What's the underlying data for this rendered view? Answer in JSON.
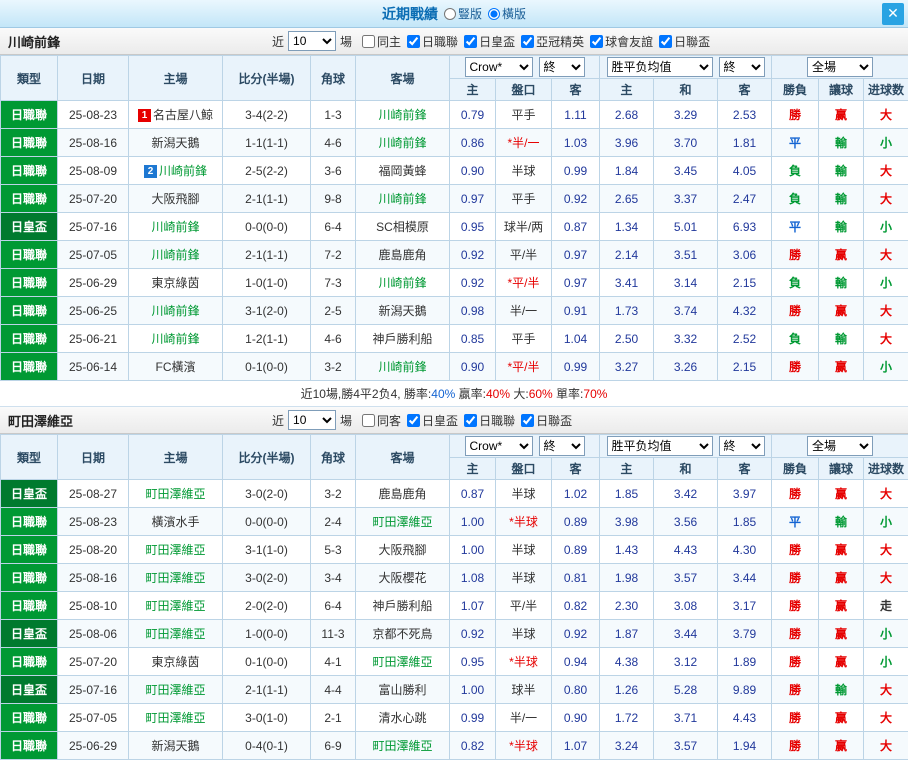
{
  "colors": {
    "red": "#e60000",
    "green": "#009933",
    "blue": "#1464d2",
    "dark": "#333333",
    "navy": "#21389b",
    "focus_team": "#009933",
    "opponent": "#333333",
    "badge_red": "#e60000",
    "badge_blue": "#1e78d2",
    "league": {
      "日職聯": "#009933",
      "日皇盃": "#007a2e"
    }
  },
  "titlebar": {
    "title": "近期戰績",
    "radios": [
      {
        "label": "豎版",
        "selected": false
      },
      {
        "label": "橫版",
        "selected": true
      }
    ],
    "close_icon": "✕"
  },
  "table_head": {
    "type": "類型",
    "date": "日期",
    "home": "主場",
    "score": "比分(半場)",
    "corner": "角球",
    "away": "客場",
    "odds_select": "Crow*",
    "end_select": "終",
    "avg_select": "胜平负均值",
    "end_select2": "終",
    "full_select": "全場",
    "sub": {
      "home": "主",
      "handicap": "盤口",
      "away": "客",
      "avg_home": "主",
      "avg_draw": "和",
      "avg_away": "客",
      "result": "勝負",
      "let": "讓球",
      "goals": "进球数"
    }
  },
  "sections": [
    {
      "team": "川崎前鋒",
      "filter": {
        "near": "近",
        "count": "10",
        "games": "場",
        "checkboxes": [
          {
            "label": "同主",
            "checked": false
          },
          {
            "label": "日職聯",
            "checked": true
          },
          {
            "label": "日皇盃",
            "checked": true
          },
          {
            "label": "亞冠精英",
            "checked": true
          },
          {
            "label": "球會友誼",
            "checked": true
          },
          {
            "label": "日聯盃",
            "checked": true
          }
        ]
      },
      "rows": [
        {
          "league": "日職聯",
          "date": "25-08-23",
          "home": {
            "name": "名古屋八鯨",
            "focus": false,
            "badge": "1",
            "badge_color": "badge_red"
          },
          "score": "3-4(2-2)",
          "corner": "1-3",
          "away": {
            "name": "川崎前鋒",
            "focus": true
          },
          "odds": {
            "home": "0.79",
            "handicap": "平手",
            "handicap_red": false,
            "away": "1.11"
          },
          "avg": {
            "home": "2.68",
            "draw": "3.29",
            "away": "2.53"
          },
          "result": {
            "text": "勝",
            "color": "red"
          },
          "let": {
            "text": "赢",
            "color": "red"
          },
          "goals": {
            "text": "大",
            "color": "red"
          }
        },
        {
          "league": "日職聯",
          "date": "25-08-16",
          "home": {
            "name": "新潟天鵝",
            "focus": false
          },
          "score": "1-1(1-1)",
          "corner": "4-6",
          "away": {
            "name": "川崎前鋒",
            "focus": true
          },
          "odds": {
            "home": "0.86",
            "handicap": "*半/一",
            "handicap_red": true,
            "away": "1.03"
          },
          "avg": {
            "home": "3.96",
            "draw": "3.70",
            "away": "1.81"
          },
          "result": {
            "text": "平",
            "color": "blue"
          },
          "let": {
            "text": "輸",
            "color": "green"
          },
          "goals": {
            "text": "小",
            "color": "green"
          }
        },
        {
          "league": "日職聯",
          "date": "25-08-09",
          "home": {
            "name": "川崎前鋒",
            "focus": true,
            "badge": "2",
            "badge_color": "badge_blue"
          },
          "score": "2-5(2-2)",
          "corner": "3-6",
          "away": {
            "name": "福岡黃蜂",
            "focus": false
          },
          "odds": {
            "home": "0.90",
            "handicap": "半球",
            "handicap_red": false,
            "away": "0.99"
          },
          "avg": {
            "home": "1.84",
            "draw": "3.45",
            "away": "4.05"
          },
          "result": {
            "text": "負",
            "color": "green"
          },
          "let": {
            "text": "輸",
            "color": "green"
          },
          "goals": {
            "text": "大",
            "color": "red"
          }
        },
        {
          "league": "日職聯",
          "date": "25-07-20",
          "home": {
            "name": "大阪飛腳",
            "focus": false
          },
          "score": "2-1(1-1)",
          "corner": "9-8",
          "away": {
            "name": "川崎前鋒",
            "focus": true
          },
          "odds": {
            "home": "0.97",
            "handicap": "平手",
            "handicap_red": false,
            "away": "0.92"
          },
          "avg": {
            "home": "2.65",
            "draw": "3.37",
            "away": "2.47"
          },
          "result": {
            "text": "負",
            "color": "green"
          },
          "let": {
            "text": "輸",
            "color": "green"
          },
          "goals": {
            "text": "大",
            "color": "red"
          }
        },
        {
          "league": "日皇盃",
          "date": "25-07-16",
          "home": {
            "name": "川崎前鋒",
            "focus": true
          },
          "score": "0-0(0-0)",
          "corner": "6-4",
          "away": {
            "name": "SC相模原",
            "focus": false
          },
          "odds": {
            "home": "0.95",
            "handicap": "球半/两",
            "handicap_red": false,
            "away": "0.87"
          },
          "avg": {
            "home": "1.34",
            "draw": "5.01",
            "away": "6.93"
          },
          "result": {
            "text": "平",
            "color": "blue"
          },
          "let": {
            "text": "輸",
            "color": "green"
          },
          "goals": {
            "text": "小",
            "color": "green"
          }
        },
        {
          "league": "日職聯",
          "date": "25-07-05",
          "home": {
            "name": "川崎前鋒",
            "focus": true
          },
          "score": "2-1(1-1)",
          "corner": "7-2",
          "away": {
            "name": "鹿島鹿角",
            "focus": false
          },
          "odds": {
            "home": "0.92",
            "handicap": "平/半",
            "handicap_red": false,
            "away": "0.97"
          },
          "avg": {
            "home": "2.14",
            "draw": "3.51",
            "away": "3.06"
          },
          "result": {
            "text": "勝",
            "color": "red"
          },
          "let": {
            "text": "赢",
            "color": "red"
          },
          "goals": {
            "text": "大",
            "color": "red"
          }
        },
        {
          "league": "日職聯",
          "date": "25-06-29",
          "home": {
            "name": "東京綠茵",
            "focus": false
          },
          "score": "1-0(1-0)",
          "corner": "7-3",
          "away": {
            "name": "川崎前鋒",
            "focus": true
          },
          "odds": {
            "home": "0.92",
            "handicap": "*平/半",
            "handicap_red": true,
            "away": "0.97"
          },
          "avg": {
            "home": "3.41",
            "draw": "3.14",
            "away": "2.15"
          },
          "result": {
            "text": "負",
            "color": "green"
          },
          "let": {
            "text": "輸",
            "color": "green"
          },
          "goals": {
            "text": "小",
            "color": "green"
          }
        },
        {
          "league": "日職聯",
          "date": "25-06-25",
          "home": {
            "name": "川崎前鋒",
            "focus": true
          },
          "score": "3-1(2-0)",
          "corner": "2-5",
          "away": {
            "name": "新潟天鵝",
            "focus": false
          },
          "odds": {
            "home": "0.98",
            "handicap": "半/一",
            "handicap_red": false,
            "away": "0.91"
          },
          "avg": {
            "home": "1.73",
            "draw": "3.74",
            "away": "4.32"
          },
          "result": {
            "text": "勝",
            "color": "red"
          },
          "let": {
            "text": "赢",
            "color": "red"
          },
          "goals": {
            "text": "大",
            "color": "red"
          }
        },
        {
          "league": "日職聯",
          "date": "25-06-21",
          "home": {
            "name": "川崎前鋒",
            "focus": true
          },
          "score": "1-2(1-1)",
          "corner": "4-6",
          "away": {
            "name": "神戶勝利船",
            "focus": false
          },
          "odds": {
            "home": "0.85",
            "handicap": "平手",
            "handicap_red": false,
            "away": "1.04"
          },
          "avg": {
            "home": "2.50",
            "draw": "3.32",
            "away": "2.52"
          },
          "result": {
            "text": "負",
            "color": "green"
          },
          "let": {
            "text": "輸",
            "color": "green"
          },
          "goals": {
            "text": "大",
            "color": "red"
          }
        },
        {
          "league": "日職聯",
          "date": "25-06-14",
          "home": {
            "name": "FC橫濱",
            "focus": false
          },
          "score": "0-1(0-0)",
          "corner": "3-2",
          "away": {
            "name": "川崎前鋒",
            "focus": true
          },
          "odds": {
            "home": "0.90",
            "handicap": "*平/半",
            "handicap_red": true,
            "away": "0.99"
          },
          "avg": {
            "home": "3.27",
            "draw": "3.26",
            "away": "2.15"
          },
          "result": {
            "text": "勝",
            "color": "red"
          },
          "let": {
            "text": "赢",
            "color": "red"
          },
          "goals": {
            "text": "小",
            "color": "green"
          }
        }
      ],
      "summary": [
        {
          "text": "近10場,勝4平2负4, 勝率:",
          "color": "dark"
        },
        {
          "text": "40%",
          "color": "blue"
        },
        {
          "text": " 贏率:",
          "color": "dark"
        },
        {
          "text": "40%",
          "color": "red"
        },
        {
          "text": " 大:",
          "color": "dark"
        },
        {
          "text": "60%",
          "color": "red"
        },
        {
          "text": " 單率:",
          "color": "dark"
        },
        {
          "text": "70%",
          "color": "red"
        }
      ]
    },
    {
      "team": "町田澤維亞",
      "filter": {
        "near": "近",
        "count": "10",
        "games": "場",
        "checkboxes": [
          {
            "label": "同客",
            "checked": false
          },
          {
            "label": "日皇盃",
            "checked": true
          },
          {
            "label": "日職聯",
            "checked": true
          },
          {
            "label": "日聯盃",
            "checked": true
          }
        ]
      },
      "rows": [
        {
          "league": "日皇盃",
          "date": "25-08-27",
          "home": {
            "name": "町田澤維亞",
            "focus": true
          },
          "score": "3-0(2-0)",
          "corner": "3-2",
          "away": {
            "name": "鹿島鹿角",
            "focus": false
          },
          "odds": {
            "home": "0.87",
            "handicap": "半球",
            "handicap_red": false,
            "away": "1.02"
          },
          "avg": {
            "home": "1.85",
            "draw": "3.42",
            "away": "3.97"
          },
          "result": {
            "text": "勝",
            "color": "red"
          },
          "let": {
            "text": "赢",
            "color": "red"
          },
          "goals": {
            "text": "大",
            "color": "red"
          }
        },
        {
          "league": "日職聯",
          "date": "25-08-23",
          "home": {
            "name": "橫濱水手",
            "focus": false
          },
          "score": "0-0(0-0)",
          "corner": "2-4",
          "away": {
            "name": "町田澤維亞",
            "focus": true
          },
          "odds": {
            "home": "1.00",
            "handicap": "*半球",
            "handicap_red": true,
            "away": "0.89"
          },
          "avg": {
            "home": "3.98",
            "draw": "3.56",
            "away": "1.85"
          },
          "result": {
            "text": "平",
            "color": "blue"
          },
          "let": {
            "text": "輸",
            "color": "green"
          },
          "goals": {
            "text": "小",
            "color": "green"
          }
        },
        {
          "league": "日職聯",
          "date": "25-08-20",
          "home": {
            "name": "町田澤維亞",
            "focus": true
          },
          "score": "3-1(1-0)",
          "corner": "5-3",
          "away": {
            "name": "大阪飛腳",
            "focus": false
          },
          "odds": {
            "home": "1.00",
            "handicap": "半球",
            "handicap_red": false,
            "away": "0.89"
          },
          "avg": {
            "home": "1.43",
            "draw": "4.43",
            "away": "4.30"
          },
          "result": {
            "text": "勝",
            "color": "red"
          },
          "let": {
            "text": "赢",
            "color": "red"
          },
          "goals": {
            "text": "大",
            "color": "red"
          }
        },
        {
          "league": "日職聯",
          "date": "25-08-16",
          "home": {
            "name": "町田澤維亞",
            "focus": true
          },
          "score": "3-0(2-0)",
          "corner": "3-4",
          "away": {
            "name": "大阪櫻花",
            "focus": false
          },
          "odds": {
            "home": "1.08",
            "handicap": "半球",
            "handicap_red": false,
            "away": "0.81"
          },
          "avg": {
            "home": "1.98",
            "draw": "3.57",
            "away": "3.44"
          },
          "result": {
            "text": "勝",
            "color": "red"
          },
          "let": {
            "text": "赢",
            "color": "red"
          },
          "goals": {
            "text": "大",
            "color": "red"
          }
        },
        {
          "league": "日職聯",
          "date": "25-08-10",
          "home": {
            "name": "町田澤維亞",
            "focus": true
          },
          "score": "2-0(2-0)",
          "corner": "6-4",
          "away": {
            "name": "神戶勝利船",
            "focus": false
          },
          "odds": {
            "home": "1.07",
            "handicap": "平/半",
            "handicap_red": false,
            "away": "0.82"
          },
          "avg": {
            "home": "2.30",
            "draw": "3.08",
            "away": "3.17"
          },
          "result": {
            "text": "勝",
            "color": "red"
          },
          "let": {
            "text": "赢",
            "color": "red"
          },
          "goals": {
            "text": "走",
            "color": "dark"
          }
        },
        {
          "league": "日皇盃",
          "date": "25-08-06",
          "home": {
            "name": "町田澤維亞",
            "focus": true
          },
          "score": "1-0(0-0)",
          "corner": "11-3",
          "away": {
            "name": "京都不死鳥",
            "focus": false
          },
          "odds": {
            "home": "0.92",
            "handicap": "半球",
            "handicap_red": false,
            "away": "0.92"
          },
          "avg": {
            "home": "1.87",
            "draw": "3.44",
            "away": "3.79"
          },
          "result": {
            "text": "勝",
            "color": "red"
          },
          "let": {
            "text": "赢",
            "color": "red"
          },
          "goals": {
            "text": "小",
            "color": "green"
          }
        },
        {
          "league": "日職聯",
          "date": "25-07-20",
          "home": {
            "name": "東京綠茵",
            "focus": false
          },
          "score": "0-1(0-0)",
          "corner": "4-1",
          "away": {
            "name": "町田澤維亞",
            "focus": true
          },
          "odds": {
            "home": "0.95",
            "handicap": "*半球",
            "handicap_red": true,
            "away": "0.94"
          },
          "avg": {
            "home": "4.38",
            "draw": "3.12",
            "away": "1.89"
          },
          "result": {
            "text": "勝",
            "color": "red"
          },
          "let": {
            "text": "赢",
            "color": "red"
          },
          "goals": {
            "text": "小",
            "color": "green"
          }
        },
        {
          "league": "日皇盃",
          "date": "25-07-16",
          "home": {
            "name": "町田澤維亞",
            "focus": true
          },
          "score": "2-1(1-1)",
          "corner": "4-4",
          "away": {
            "name": "富山勝利",
            "focus": false
          },
          "odds": {
            "home": "1.00",
            "handicap": "球半",
            "handicap_red": false,
            "away": "0.80"
          },
          "avg": {
            "home": "1.26",
            "draw": "5.28",
            "away": "9.89"
          },
          "result": {
            "text": "勝",
            "color": "red"
          },
          "let": {
            "text": "輸",
            "color": "green"
          },
          "goals": {
            "text": "大",
            "color": "red"
          }
        },
        {
          "league": "日職聯",
          "date": "25-07-05",
          "home": {
            "name": "町田澤維亞",
            "focus": true
          },
          "score": "3-0(1-0)",
          "corner": "2-1",
          "away": {
            "name": "清水心跳",
            "focus": false
          },
          "odds": {
            "home": "0.99",
            "handicap": "半/一",
            "handicap_red": false,
            "away": "0.90"
          },
          "avg": {
            "home": "1.72",
            "draw": "3.71",
            "away": "4.43"
          },
          "result": {
            "text": "勝",
            "color": "red"
          },
          "let": {
            "text": "赢",
            "color": "red"
          },
          "goals": {
            "text": "大",
            "color": "red"
          }
        },
        {
          "league": "日職聯",
          "date": "25-06-29",
          "home": {
            "name": "新潟天鵝",
            "focus": false
          },
          "score": "0-4(0-1)",
          "corner": "6-9",
          "away": {
            "name": "町田澤維亞",
            "focus": true
          },
          "odds": {
            "home": "0.82",
            "handicap": "*半球",
            "handicap_red": true,
            "away": "1.07"
          },
          "avg": {
            "home": "3.24",
            "draw": "3.57",
            "away": "1.94"
          },
          "result": {
            "text": "勝",
            "color": "red"
          },
          "let": {
            "text": "赢",
            "color": "red"
          },
          "goals": {
            "text": "大",
            "color": "red"
          }
        }
      ],
      "summary": []
    }
  ]
}
